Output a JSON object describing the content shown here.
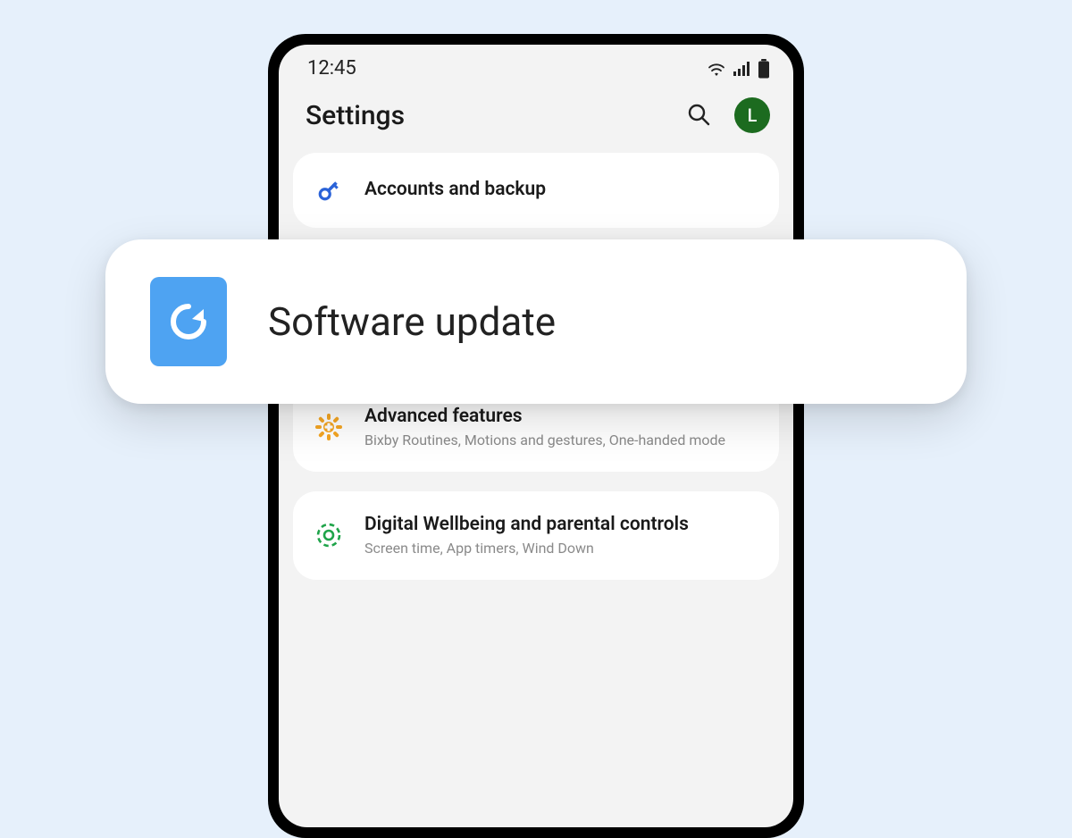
{
  "statusbar": {
    "time": "12:45"
  },
  "header": {
    "title": "Settings"
  },
  "avatar": {
    "initial": "L",
    "bg": "#1c6b1f"
  },
  "settings": {
    "accounts": {
      "title": "Accounts and backup"
    },
    "advanced": {
      "title": "Advanced features",
      "sub": "Bixby Routines, Motions and gestures, One-handed mode"
    },
    "wellbeing": {
      "title": "Digital Wellbeing and parental controls",
      "sub": "Screen time, App timers, Wind Down"
    }
  },
  "overlay": {
    "label": "Software update"
  },
  "colors": {
    "page_bg": "#e6f0fb",
    "overlay_icon_bg": "#4ea3f2",
    "avatar_bg": "#1c6b1f",
    "accounts_icon": "#2b63d8",
    "advanced_icon": "#f5a623",
    "wellbeing_icon": "#1fa44a"
  }
}
